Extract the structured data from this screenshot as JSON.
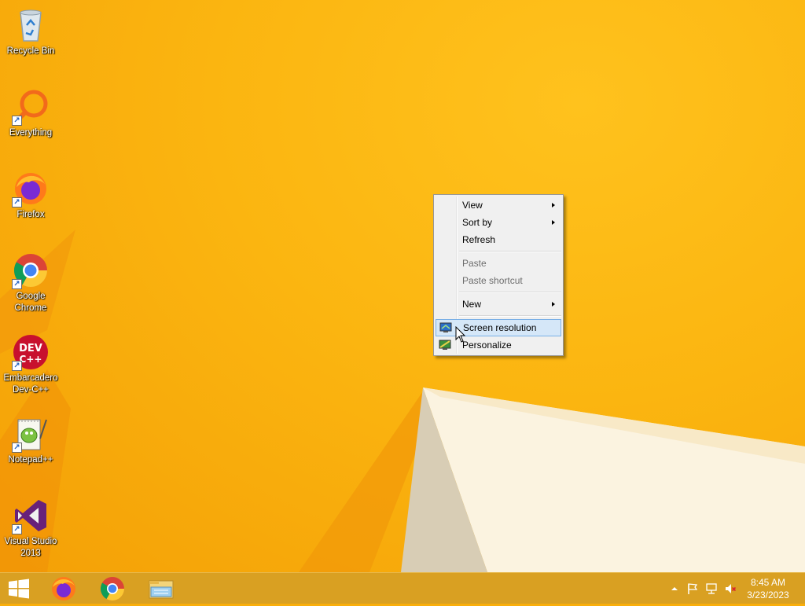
{
  "desktop": {
    "icons": [
      {
        "label": "Recycle Bin",
        "icon": "recycle-bin-icon"
      },
      {
        "label": "Everything",
        "icon": "everything-search-icon"
      },
      {
        "label": "Firefox",
        "icon": "firefox-icon"
      },
      {
        "label": "Google Chrome",
        "icon": "chrome-icon"
      },
      {
        "label": "Embarcadero Dev-C++",
        "icon": "dev-cpp-icon",
        "badge": "DEV C++"
      },
      {
        "label": "Notepad++",
        "icon": "notepad-plus-plus-icon"
      },
      {
        "label": "Visual Studio 2013",
        "icon": "visual-studio-icon"
      }
    ]
  },
  "context_menu": {
    "items": [
      {
        "label": "View",
        "submenu": true
      },
      {
        "label": "Sort by",
        "submenu": true
      },
      {
        "label": "Refresh"
      },
      {
        "label": "Paste",
        "disabled": true
      },
      {
        "label": "Paste shortcut",
        "disabled": true
      },
      {
        "label": "New",
        "submenu": true
      },
      {
        "label": "Screen resolution",
        "highlighted": true,
        "icon": "screen-resolution-icon"
      },
      {
        "label": "Personalize",
        "icon": "personalize-icon"
      }
    ]
  },
  "taskbar": {
    "pinned": [
      "start-icon",
      "firefox-icon",
      "chrome-icon",
      "file-explorer-icon"
    ],
    "tray": [
      "show-hidden-icons-icon",
      "action-center-flag-icon",
      "network-icon",
      "volume-muted-icon"
    ],
    "clock": {
      "time": "8:45 AM",
      "date": "3/23/2023"
    }
  },
  "colors": {
    "wallpaper": "#f9ae0b",
    "taskbar": "#d9a022",
    "menu_highlight": "#d5e7f8"
  }
}
